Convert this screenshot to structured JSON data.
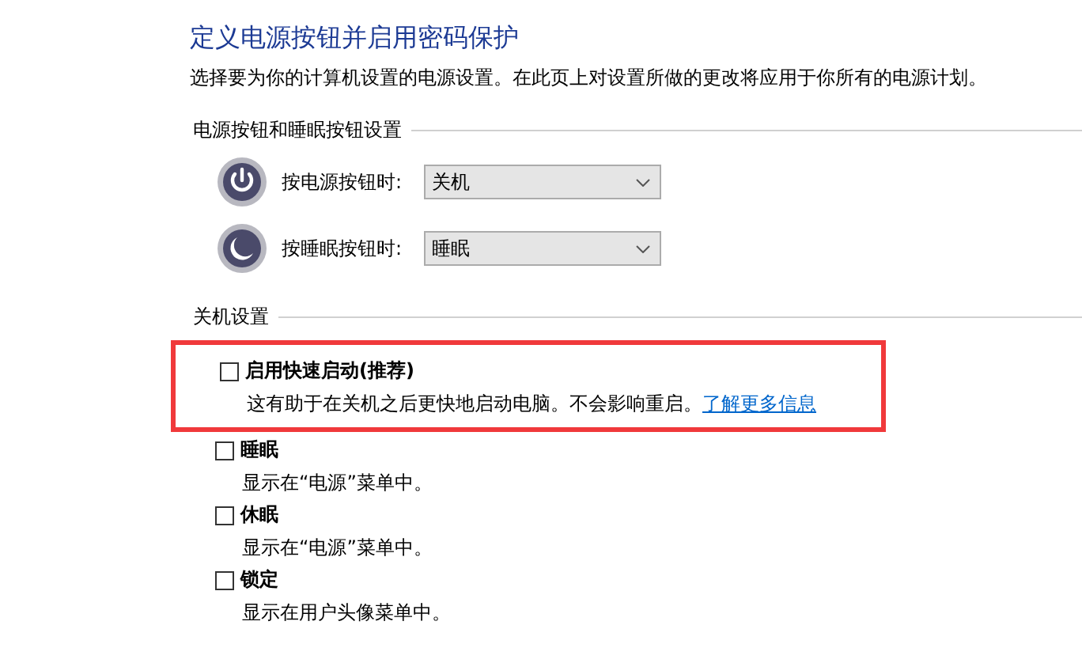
{
  "title": "定义电源按钮并启用密码保护",
  "description": "选择要为你的计算机设置的电源设置。在此页上对设置所做的更改将应用于你所有的电源计划。",
  "button_section": {
    "heading": "电源按钮和睡眠按钮设置",
    "rows": [
      {
        "kind": "power",
        "label": "按电源按钮时:",
        "value": "关机"
      },
      {
        "kind": "sleep",
        "label": "按睡眠按钮时:",
        "value": "睡眠"
      }
    ]
  },
  "shutdown_section": {
    "heading": "关机设置",
    "options": [
      {
        "label": "启用快速启动(推荐)",
        "checked": false,
        "highlighted": true,
        "description": "这有助于在关机之后更快地启动电脑。不会影响重启。",
        "link": "了解更多信息"
      },
      {
        "label": "睡眠",
        "checked": false,
        "highlighted": false,
        "description": "显示在“电源”菜单中。"
      },
      {
        "label": "休眠",
        "checked": false,
        "highlighted": false,
        "description": "显示在“电源”菜单中。"
      },
      {
        "label": "锁定",
        "checked": false,
        "highlighted": false,
        "description": "显示在用户头像菜单中。"
      }
    ]
  }
}
